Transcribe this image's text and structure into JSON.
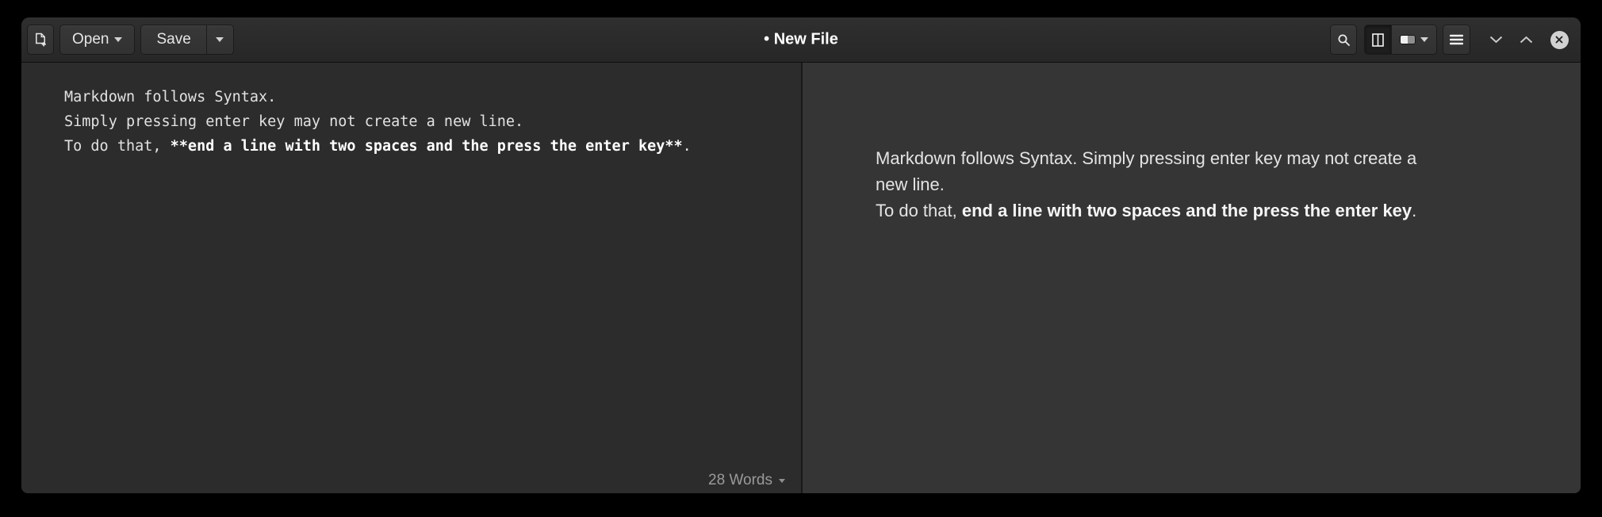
{
  "header": {
    "title": "• New File",
    "open_label": "Open",
    "save_label": "Save",
    "icons": {
      "new_file": "new-document-icon",
      "open_dropdown": "dropdown-arrow-icon",
      "save_dropdown": "dropdown-arrow-icon",
      "search": "search-icon",
      "split_view": "split-view-icon",
      "split_view_active": true,
      "preview_mode": "preview-toggle-icon",
      "menu": "hamburger-menu-icon",
      "chevron_down": "chevron-down-icon",
      "chevron_up": "chevron-up-icon",
      "close": "close-icon"
    }
  },
  "editor": {
    "word_count": "28 Words",
    "lines": [
      {
        "segments": [
          {
            "text": "Markdown follows Syntax.",
            "bold": false
          }
        ]
      },
      {
        "segments": [
          {
            "text": "Simply pressing enter key may not create a new line.",
            "bold": false
          }
        ]
      },
      {
        "segments": [
          {
            "text": "To do that, ",
            "bold": false
          },
          {
            "text": "**end a line with two spaces and the press the enter key**",
            "bold": true
          },
          {
            "text": ".",
            "bold": false
          }
        ]
      }
    ]
  },
  "preview": {
    "lines": [
      {
        "segments": [
          {
            "text": "Markdown follows Syntax. Simply pressing enter key may not create a",
            "bold": false
          }
        ]
      },
      {
        "segments": [
          {
            "text": "new line.",
            "bold": false
          }
        ]
      },
      {
        "segments": [
          {
            "text": "To do that, ",
            "bold": false
          },
          {
            "text": "end a line with two spaces and the press the enter key",
            "bold": true
          },
          {
            "text": ".",
            "bold": false
          }
        ]
      }
    ]
  },
  "theme": {
    "window_bg": "#2c2c2c",
    "headerbar_top": "#2f2f2f",
    "headerbar_bottom": "#272727",
    "button_bg": "#383838",
    "button_active_bg": "#1e1e1e",
    "editor_bg": "#2c2c2c",
    "preview_bg": "#353535",
    "editor_text": "#e2e2e2",
    "preview_text": "#e4e4e4",
    "muted_text": "#9a9a9a",
    "title_text": "#ffffff"
  }
}
